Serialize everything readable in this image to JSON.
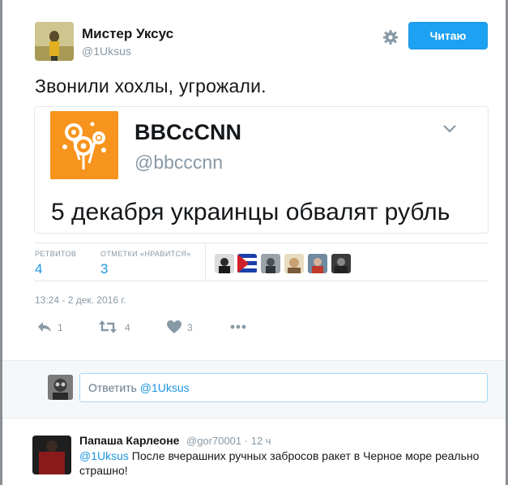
{
  "author": {
    "name": "Мистер Уксус",
    "handle": "@1Uksus"
  },
  "follow_button": {
    "label": "Читаю"
  },
  "tweet": {
    "text": "Звонили хохлы, угрожали.",
    "timestamp": "13:24 - 2 дек. 2016 г."
  },
  "quote": {
    "name": "BBCcCNN",
    "handle": "@bbcccnn",
    "text": "5 декабря украинцы обвалят рубль"
  },
  "stats": {
    "retweets_label": "РЕТВИТОВ",
    "retweets": "4",
    "likes_label": "ОТМЕТКИ «НРАВИТСЯ»",
    "likes": "3",
    "liker_avatars": [
      "liker-avatar-1",
      "liker-avatar-2",
      "liker-avatar-3",
      "liker-avatar-4",
      "liker-avatar-5",
      "liker-avatar-6"
    ]
  },
  "actions": {
    "reply_count": "1",
    "retweet_count": "4",
    "like_count": "3"
  },
  "reply_box": {
    "prefix": "Ответить ",
    "mention": "@1Uksus"
  },
  "reply": {
    "name": "Папаша Карлеоне",
    "handle": "@gor70001",
    "separator": "·",
    "time": "12 ч",
    "mention": "@1Uksus",
    "text": " После вчерашних ручных забросов ракет в Черное море реально страшно!"
  },
  "colors": {
    "accent": "#1da1f2",
    "link": "#1b95e0",
    "muted": "#8899a6",
    "quote_avatar_bg": "#f7941d"
  }
}
